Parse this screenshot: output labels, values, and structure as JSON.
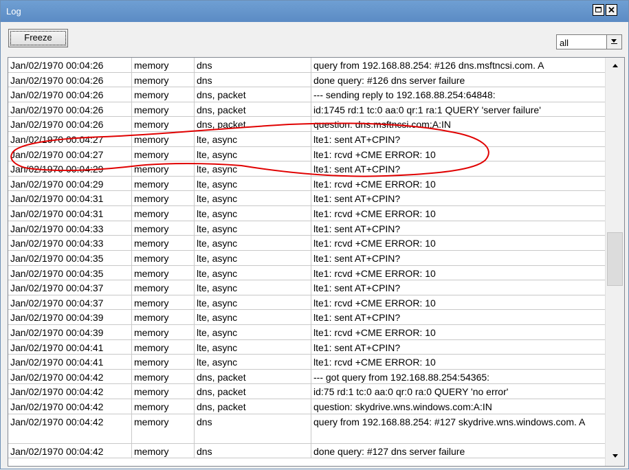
{
  "window": {
    "title": "Log"
  },
  "toolbar": {
    "freeze_label": "Freeze",
    "filter_value": "all"
  },
  "log": {
    "rows": [
      {
        "time": "Jan/02/1970 00:04:26",
        "buffer": "memory",
        "topics": "dns",
        "message": "query from 192.168.88.254: #126 dns.msftncsi.com. A"
      },
      {
        "time": "Jan/02/1970 00:04:26",
        "buffer": "memory",
        "topics": "dns",
        "message": "done query: #126 dns server failure"
      },
      {
        "time": "Jan/02/1970 00:04:26",
        "buffer": "memory",
        "topics": "dns, packet",
        "message": "--- sending reply to 192.168.88.254:64848:"
      },
      {
        "time": "Jan/02/1970 00:04:26",
        "buffer": "memory",
        "topics": "dns, packet",
        "message": "id:1745 rd:1 tc:0 aa:0 qr:1 ra:1 QUERY 'server failure'"
      },
      {
        "time": "Jan/02/1970 00:04:26",
        "buffer": "memory",
        "topics": "dns, packet",
        "message": "question: dns.msftncsi.com:A:IN"
      },
      {
        "time": "Jan/02/1970 00:04:27",
        "buffer": "memory",
        "topics": "lte, async",
        "message": "lte1: sent AT+CPIN?"
      },
      {
        "time": "Jan/02/1970 00:04:27",
        "buffer": "memory",
        "topics": "lte, async",
        "message": "lte1: rcvd +CME ERROR: 10"
      },
      {
        "time": "Jan/02/1970 00:04:29",
        "buffer": "memory",
        "topics": "lte, async",
        "message": "lte1: sent AT+CPIN?"
      },
      {
        "time": "Jan/02/1970 00:04:29",
        "buffer": "memory",
        "topics": "lte, async",
        "message": "lte1: rcvd +CME ERROR: 10"
      },
      {
        "time": "Jan/02/1970 00:04:31",
        "buffer": "memory",
        "topics": "lte, async",
        "message": "lte1: sent AT+CPIN?"
      },
      {
        "time": "Jan/02/1970 00:04:31",
        "buffer": "memory",
        "topics": "lte, async",
        "message": "lte1: rcvd +CME ERROR: 10"
      },
      {
        "time": "Jan/02/1970 00:04:33",
        "buffer": "memory",
        "topics": "lte, async",
        "message": "lte1: sent AT+CPIN?"
      },
      {
        "time": "Jan/02/1970 00:04:33",
        "buffer": "memory",
        "topics": "lte, async",
        "message": "lte1: rcvd +CME ERROR: 10"
      },
      {
        "time": "Jan/02/1970 00:04:35",
        "buffer": "memory",
        "topics": "lte, async",
        "message": "lte1: sent AT+CPIN?"
      },
      {
        "time": "Jan/02/1970 00:04:35",
        "buffer": "memory",
        "topics": "lte, async",
        "message": "lte1: rcvd +CME ERROR: 10"
      },
      {
        "time": "Jan/02/1970 00:04:37",
        "buffer": "memory",
        "topics": "lte, async",
        "message": "lte1: sent AT+CPIN?"
      },
      {
        "time": "Jan/02/1970 00:04:37",
        "buffer": "memory",
        "topics": "lte, async",
        "message": "lte1: rcvd +CME ERROR: 10"
      },
      {
        "time": "Jan/02/1970 00:04:39",
        "buffer": "memory",
        "topics": "lte, async",
        "message": "lte1: sent AT+CPIN?"
      },
      {
        "time": "Jan/02/1970 00:04:39",
        "buffer": "memory",
        "topics": "lte, async",
        "message": "lte1: rcvd +CME ERROR: 10"
      },
      {
        "time": "Jan/02/1970 00:04:41",
        "buffer": "memory",
        "topics": "lte, async",
        "message": "lte1: sent AT+CPIN?"
      },
      {
        "time": "Jan/02/1970 00:04:41",
        "buffer": "memory",
        "topics": "lte, async",
        "message": "lte1: rcvd +CME ERROR: 10"
      },
      {
        "time": "Jan/02/1970 00:04:42",
        "buffer": "memory",
        "topics": "dns, packet",
        "message": "--- got query from 192.168.88.254:54365:"
      },
      {
        "time": "Jan/02/1970 00:04:42",
        "buffer": "memory",
        "topics": "dns, packet",
        "message": "id:75 rd:1 tc:0 aa:0 qr:0 ra:0 QUERY 'no error'"
      },
      {
        "time": "Jan/02/1970 00:04:42",
        "buffer": "memory",
        "topics": "dns, packet",
        "message": "question: skydrive.wns.windows.com:A:IN"
      },
      {
        "time": "Jan/02/1970 00:04:42",
        "buffer": "memory",
        "topics": "dns",
        "message": "query from 192.168.88.254: #127 skydrive.wns.windows.com. A",
        "tall": true
      },
      {
        "time": "Jan/02/1970 00:04:42",
        "buffer": "memory",
        "topics": "dns",
        "message": "done query: #127 dns server failure"
      }
    ]
  },
  "annotation": {
    "color": "#e00000"
  }
}
